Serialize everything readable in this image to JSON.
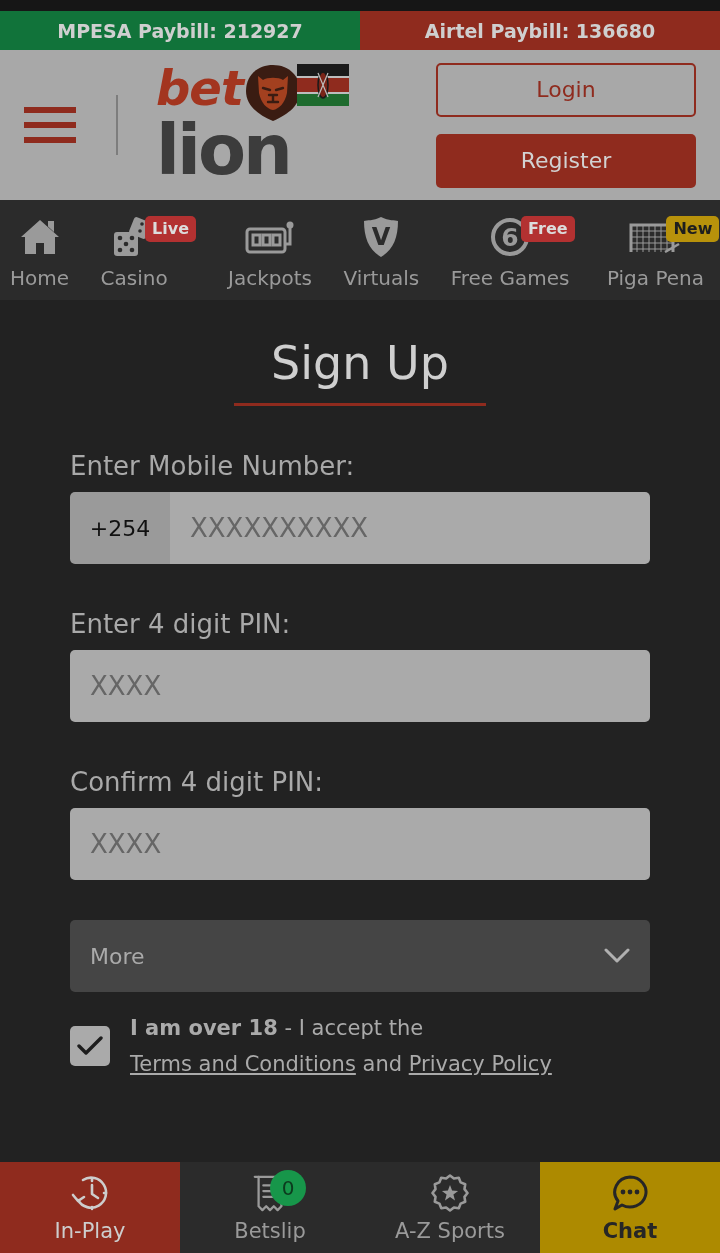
{
  "paybills": [
    {
      "label": "MPESA Paybill: 212927",
      "color": "#11733a"
    },
    {
      "label": "Airtel Paybill: 136680",
      "color": "#8f2b1e"
    }
  ],
  "header": {
    "logo": {
      "word_1": "bet",
      "word_2": "lion"
    },
    "buttons": [
      {
        "label": "Login",
        "kind": "outline"
      },
      {
        "label": "Register",
        "kind": "filled"
      }
    ]
  },
  "nav": [
    {
      "label": "Home"
    },
    {
      "label": "Casino",
      "badge": {
        "label": "Live",
        "kind": "promo"
      }
    },
    {
      "label": "Jackpots"
    },
    {
      "label": "Virtuals",
      "glyph": "V"
    },
    {
      "label": "Free Games",
      "glyph": "6",
      "badge": {
        "label": "Free",
        "kind": "promo"
      }
    },
    {
      "label": "Piga Pena",
      "badge": {
        "label": "New",
        "kind": "new"
      }
    }
  ],
  "form": {
    "title": "Sign Up",
    "fields": [
      {
        "kind": "phone",
        "label": "Enter Mobile Number:",
        "prefix": "+254",
        "placeholder": "XXXXXXXXXX"
      },
      {
        "kind": "pin",
        "label": "Enter 4 digit PIN:",
        "placeholder": "XXXX"
      },
      {
        "kind": "pin",
        "label": "Confirm 4 digit PIN:",
        "placeholder": "XXXX"
      }
    ],
    "more": {
      "label": "More",
      "expanded": false
    },
    "consent": {
      "checked": true,
      "segments": [
        {
          "kind": "text",
          "text": "**I am over 18** - I accept the "
        },
        {
          "kind": "link",
          "text": "Terms and Conditions"
        },
        {
          "kind": "text",
          "text": " and "
        },
        {
          "kind": "link",
          "text": "Privacy Policy"
        }
      ]
    }
  },
  "bottom_nav": [
    {
      "label": "In-Play",
      "kind": "live"
    },
    {
      "label": "Betslip",
      "kind": "plain",
      "count": "0"
    },
    {
      "label": "A-Z Sports",
      "kind": "plain"
    },
    {
      "label": "Chat",
      "kind": "chat"
    }
  ]
}
